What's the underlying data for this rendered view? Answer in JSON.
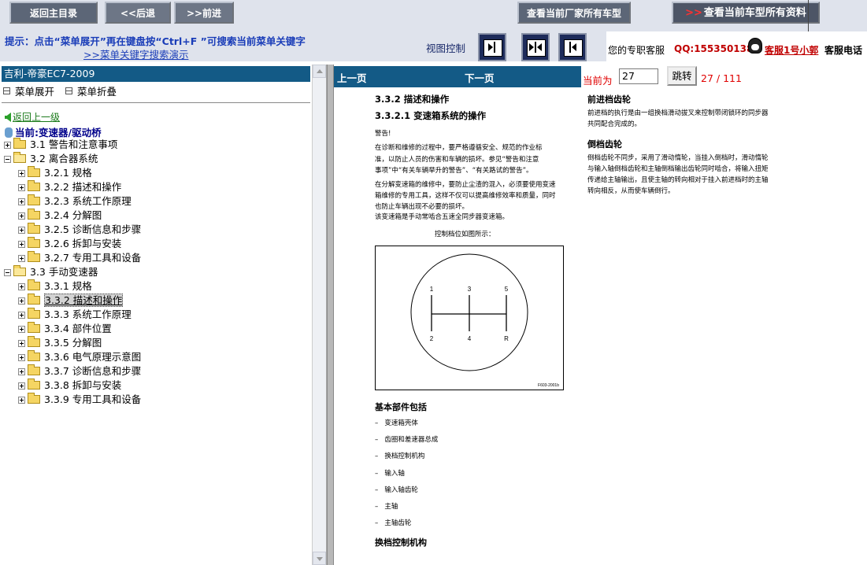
{
  "toolbar": {
    "main_menu": "返回主目录",
    "back": "<<后退",
    "forward": ">>前进",
    "all_models": "查看当前厂家所有车型",
    "all_info_arrow": ">>",
    "all_info": "查看当前车型所有资料"
  },
  "hint": {
    "text": "提示：点击“菜单展开”再在键盘按“Ctrl+F ”可搜索当前菜单关键字",
    "link": ">>菜单关键字搜索演示",
    "view_label": "视图控制"
  },
  "support": {
    "label": "您的专职客服",
    "qq": "QQ:1553501388",
    "service": "客服1号小郭",
    "phone": "客服电话"
  },
  "sidebar": {
    "title": "吉利-帝豪EC7-2009",
    "expand": "菜单展开",
    "collapse": "菜单折叠",
    "back_link": "返回上一级",
    "current": "当前:变速器/驱动桥",
    "items": [
      {
        "label": "3.1 警告和注意事项"
      },
      {
        "label": "3.2 离合器系统"
      },
      {
        "label": "3.2.1 规格"
      },
      {
        "label": "3.2.2 描述和操作"
      },
      {
        "label": "3.2.3 系统工作原理"
      },
      {
        "label": "3.2.4 分解图"
      },
      {
        "label": "3.2.5 诊断信息和步骤"
      },
      {
        "label": "3.2.6 拆卸与安装"
      },
      {
        "label": "3.2.7 专用工具和设备"
      },
      {
        "label": "3.3 手动变速器"
      },
      {
        "label": "3.3.1 规格"
      },
      {
        "label": "3.3.2 描述和操作"
      },
      {
        "label": "3.3.3 系统工作原理"
      },
      {
        "label": "3.3.4 部件位置"
      },
      {
        "label": "3.3.5 分解图"
      },
      {
        "label": "3.3.6 电气原理示意图"
      },
      {
        "label": "3.3.7 诊断信息和步骤"
      },
      {
        "label": "3.3.8 拆卸与安装"
      },
      {
        "label": "3.3.9 专用工具和设备"
      }
    ]
  },
  "nav": {
    "prev": "上一页",
    "next": "下一页",
    "current_label": "当前为",
    "page_value": "27",
    "jump": "跳转",
    "total": "27 / 111"
  },
  "doc": {
    "h1": "3.3.2 描述和操作",
    "h2": "3.3.2.1 变速箱系统的操作",
    "warning": "警告!",
    "p1": "在诊断和维修的过程中，要严格遵循安全、规范的作业标",
    "p2": "准，以防止人员的伤害和车辆的损坏。参见“警告和注意",
    "p3": "事项”中“有关车辆举升的警告”、“有关路试的警告”。",
    "p4": "在分解变速箱的维修中，要防止尘渣的混入，必须要使用变速",
    "p5": "箱维修的专用工具，这样不仅可以提高维修效率和质量，同时",
    "p6": "也防止车辆出现不必要的损坏。",
    "p7": "该变速箱是手动常啮合五速全同步器变速箱。",
    "diagram_caption": "控制档位如图所示：",
    "gears_top": [
      "1",
      "3",
      "5"
    ],
    "gears_bottom": [
      "2",
      "4",
      "R"
    ],
    "diagram_code": "F603-2001b",
    "parts_heading": "基本部件包括",
    "parts": [
      "变速箱壳体",
      "齿圈和差速器总成",
      "换档控制机构",
      "输入轴",
      "输入轴齿轮",
      "主轴",
      "主轴齿轮"
    ],
    "shift_heading": "换档控制机构",
    "forward_heading": "前进档齿轮",
    "forward_p1": "前进档的执行是由一组换档滑动拔叉来控制带闭锁环的同步器",
    "forward_p2": "共同配合完成的。",
    "reverse_heading": "倒档齿轮",
    "reverse_p1": "倒档齿轮不同步，采用了滑动惰轮，当挂入倒档时，滑动惰轮",
    "reverse_p2": "与输入轴倒档齿轮和主轴倒档输出齿轮同时啮合，将输入扭矩",
    "reverse_p3": "传递给主轴输出，且使主轴的转向相对于挂入前进档时的主轴",
    "reverse_p4": "转向相反，从而使车辆倒行。"
  }
}
